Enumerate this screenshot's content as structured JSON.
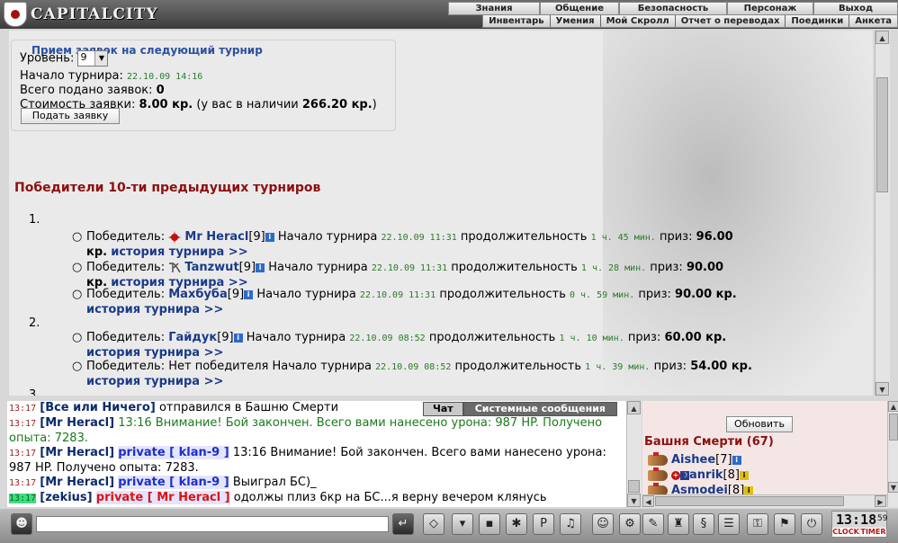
{
  "app": {
    "logo_text": "CAPITALCITY"
  },
  "menu_main": [
    "Знания",
    "Общение",
    "Безопасность",
    "Персонаж",
    "Выход"
  ],
  "menu_sub": [
    "Инвентарь",
    "Умения",
    "Мой Скролл",
    "Отчет о переводах",
    "Поединки",
    "Анкета"
  ],
  "signup": {
    "title": "Прием заявок на следующий турнир",
    "level_label": "Уровень:",
    "level_value": "9",
    "start_label": "Начало турнира:",
    "start_value": "22.10.09 14:16",
    "total_label": "Всего подано заявок:",
    "total_value": "0",
    "cost_label": "Стоимость заявки:",
    "cost_value": "8.00 кр.",
    "balance_prefix": "(у вас в наличии",
    "balance_value": "266.20 кр.",
    "balance_suffix": ")",
    "submit": "Подать заявку"
  },
  "winners": {
    "title": "Победители 10-ти предыдущих турниров",
    "groups": [
      {
        "num": "1.",
        "entries": [
          {
            "winner_label": "Победитель:",
            "name": "Mr Heracl",
            "level": "[9]",
            "start_label": "Начало турнира",
            "start": "22.10.09 11:31",
            "dur_label": "продолжительность",
            "dur": "1 ч. 45 мин.",
            "prize_label": "приз:",
            "prize": "96.00",
            "prize_unit": "кр.",
            "history": "история турнира >>"
          },
          {
            "winner_label": "Победитель:",
            "name": "Tanzwut",
            "level": "[9]",
            "start_label": "Начало турнира",
            "start": "22.10.09 11:31",
            "dur_label": "продолжительность",
            "dur": "1 ч. 28 мин.",
            "prize_label": "приз:",
            "prize": "90.00",
            "prize_unit": "кр.",
            "history": "история турнира >>"
          },
          {
            "winner_label": "Победитель:",
            "name": "Махбуба",
            "level": "[9]",
            "start_label": "Начало турнира",
            "start": "22.10.09 11:31",
            "dur_label": "продолжительность",
            "dur": "0 ч. 59 мин.",
            "prize_label": "приз:",
            "prize": "90.00 кр.",
            "history": "история турнира >>"
          }
        ]
      },
      {
        "num": "2.",
        "entries": [
          {
            "winner_label": "Победитель:",
            "name": "Гайдук",
            "level": "[9]",
            "start_label": "Начало турнира",
            "start": "22.10.09 08:52",
            "dur_label": "продолжительность",
            "dur": "1 ч. 10 мин.",
            "prize_label": "приз:",
            "prize": "60.00 кр.",
            "history": "история турнира >>"
          },
          {
            "winner_label": "Победитель:",
            "no_winner": "Нет победителя",
            "start_label": "Начало турнира",
            "start": "22.10.09 08:52",
            "dur_label": "продолжительность",
            "dur": "1 ч. 39 мин.",
            "prize_label": "приз:",
            "prize": "54.00 кр.",
            "history": "история турнира >>"
          }
        ]
      },
      {
        "num": "3.",
        "entries": []
      }
    ]
  },
  "chat_tabs": {
    "chat": "Чат",
    "system": "Системные сообщения"
  },
  "chat": [
    {
      "time": "13:17",
      "nick": "[Все или Ничего]",
      "text": "отправился в Башню Смерти",
      "kind": "plain"
    },
    {
      "time": "13:17",
      "nick": "[Mr Heracl]",
      "text": "13:16 Внимание! Бой закончен. Всего вами нанесено урона: 987 HP. Получено опыта: 7283.",
      "kind": "sys"
    },
    {
      "time": "13:17",
      "nick": "[Mr Heracl]",
      "priv": "private [ klan-9 ]",
      "text": "13:16 Внимание! Бой закончен. Всего вами нанесено урона: 987 HP. Получено опыта: 7283.",
      "kind": "plain"
    },
    {
      "time": "13:17",
      "nick": "[Mr Heracl]",
      "priv": "private [ klan-9 ]",
      "text": "Выиграл БС)_",
      "kind": "plain"
    },
    {
      "time": "13:17",
      "nick": "[zekius]",
      "priv": "private [ Mr Heracl ]",
      "text": "одолжы плиз 6кр на БС...я верну вечером клянусь",
      "kind": "plain"
    }
  ],
  "right_panel": {
    "refresh": "Обновить",
    "tower": "Башня Смерти (67)",
    "users": [
      {
        "name": "Aishee",
        "level": "[7]"
      },
      {
        "name": "anrik",
        "level": "[8]"
      },
      {
        "name": "Asmodei",
        "level": "[8]"
      }
    ]
  },
  "clock": {
    "time": "13:18",
    "sec": "59",
    "label1": "CLOCK",
    "label2": "TIMER"
  },
  "toolbar_icons": [
    "send-icon",
    "eraser-icon",
    "filter-icon",
    "save-icon",
    "dance-icon",
    "translit-icon",
    "music-icon",
    "smile-icon",
    "settings-icon",
    "feather-icon",
    "potion-icon",
    "scroll-icon",
    "group-icon",
    "lock-icon",
    "flag-icon",
    "exit-icon"
  ],
  "colors": {
    "header": "#8b1010",
    "link": "#1a3a8a",
    "private": "#1a30c8",
    "system_text": "#1a7a1a",
    "time": "#a02020",
    "right_bg": "#f5e6e6"
  }
}
